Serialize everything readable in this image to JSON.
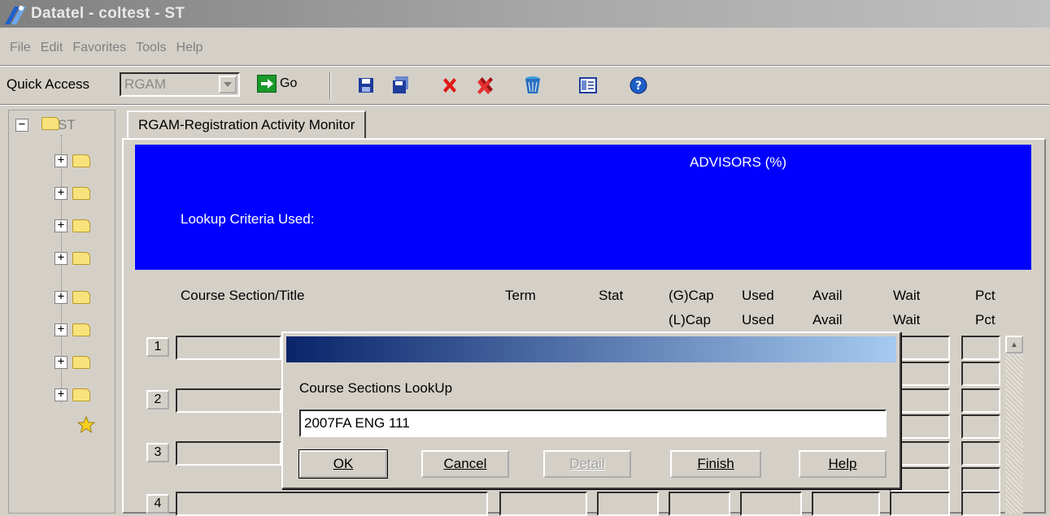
{
  "window": {
    "title": "Datatel - coltest - ST"
  },
  "menu": [
    "File",
    "Edit",
    "Favorites",
    "Tools",
    "Help"
  ],
  "toolbar": {
    "quick_access_label": "Quick Access",
    "quick_access_value": "RGAM",
    "go_label": "Go",
    "icons": [
      "save-icon",
      "save-all-icon",
      "cancel-icon",
      "cancel-all-icon",
      "trash-icon",
      "form-icon",
      "help-icon"
    ]
  },
  "tree": {
    "root_label": "ST",
    "child_count_shown": 8
  },
  "tab": {
    "label": "RGAM-Registration Activity Monitor"
  },
  "banner": {
    "heading": "ADVISORS (%)",
    "criteria_label": "Lookup Criteria Used:"
  },
  "columns": {
    "course": "Course Section/Title",
    "term": "Term",
    "stat": "Stat",
    "cap1": "(G)Cap",
    "cap2": "(L)Cap",
    "used1": "Used",
    "used2": "Used",
    "avail1": "Avail",
    "avail2": "Avail",
    "wait1": "Wait",
    "wait2": "Wait",
    "pct1": "Pct",
    "pct2": "Pct"
  },
  "rows": [
    "1",
    "2",
    "3",
    "4"
  ],
  "dialog": {
    "prompt": "Course Sections LookUp",
    "value": "2007FA ENG 111",
    "buttons": {
      "ok": "OK",
      "cancel": "Cancel",
      "detail": "Detail",
      "finish": "Finish",
      "help": "Help"
    }
  }
}
